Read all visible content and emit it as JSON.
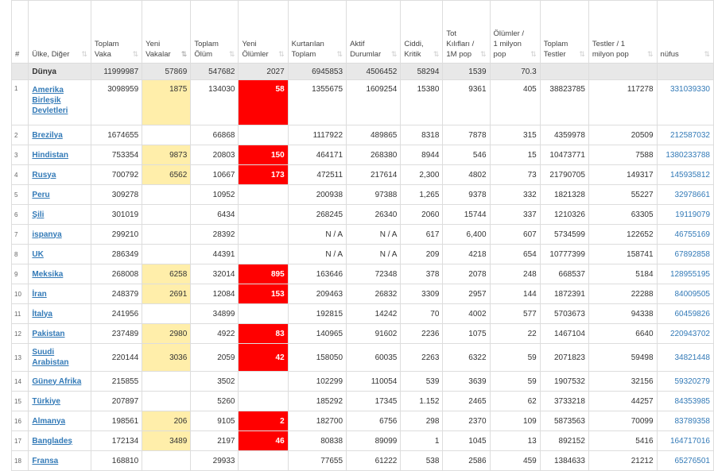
{
  "columns": [
    {
      "label": "#",
      "sort": false
    },
    {
      "label": "Ülke, Diğer",
      "sort": true
    },
    {
      "label": "Toplam Vaka",
      "sort": true
    },
    {
      "label": "Yeni Vakalar",
      "sort": true,
      "active": true
    },
    {
      "label": "Toplam Ölüm",
      "sort": true
    },
    {
      "label": "Yeni Ölümler",
      "sort": true
    },
    {
      "label": "Kurtarılan Toplam",
      "sort": true
    },
    {
      "label": "Aktif Durumlar",
      "sort": true
    },
    {
      "label": "Ciddi, Kritik",
      "sort": true
    },
    {
      "label": "Tot Kılıfları / 1M pop",
      "sort": true
    },
    {
      "label": "Ölümler / 1 milyon pop",
      "sort": true
    },
    {
      "label": "Toplam Testler",
      "sort": true
    },
    {
      "label": "Testler / 1 milyon pop",
      "sort": true
    },
    {
      "label": "nüfus",
      "sort": true
    }
  ],
  "sort_icon": "sort-arrows-icon",
  "world": {
    "idx": "",
    "country": "Dünya",
    "total": "11999987",
    "new_cases": "57869",
    "deaths": "547682",
    "new_deaths": "2027",
    "recovered": "6945853",
    "active": "4506452",
    "critical": "58294",
    "per_million": "1539",
    "deaths_per_million": "70.3",
    "tests": "",
    "tests_per_million": "",
    "population": ""
  },
  "rows": [
    {
      "idx": "1",
      "country": "Amerika Birleşik Devletleri",
      "total": "3098959",
      "new_cases": "1875",
      "deaths": "134030",
      "new_deaths": "58",
      "recovered": "1355675",
      "active": "1609254",
      "critical": "15380",
      "per_million": "9361",
      "deaths_per_million": "405",
      "tests": "38823785",
      "tests_per_million": "117278",
      "population": "331039330"
    },
    {
      "idx": "2",
      "country": "Brezilya",
      "total": "1674655",
      "new_cases": "",
      "deaths": "66868",
      "new_deaths": "",
      "recovered": "1117922",
      "active": "489865",
      "critical": "8318",
      "per_million": "7878",
      "deaths_per_million": "315",
      "tests": "4359978",
      "tests_per_million": "20509",
      "population": "212587032"
    },
    {
      "idx": "3",
      "country": "Hindistan",
      "total": "753354",
      "new_cases": "9873",
      "deaths": "20803",
      "new_deaths": "150",
      "recovered": "464171",
      "active": "268380",
      "critical": "8944",
      "per_million": "546",
      "deaths_per_million": "15",
      "tests": "10473771",
      "tests_per_million": "7588",
      "population": "1380233788"
    },
    {
      "idx": "4",
      "country": "Rusya",
      "total": "700792",
      "new_cases": "6562",
      "deaths": "10667",
      "new_deaths": "173",
      "recovered": "472511",
      "active": "217614",
      "critical": "2,300",
      "per_million": "4802",
      "deaths_per_million": "73",
      "tests": "21790705",
      "tests_per_million": "149317",
      "population": "145935812"
    },
    {
      "idx": "5",
      "country": "Peru",
      "total": "309278",
      "new_cases": "",
      "deaths": "10952",
      "new_deaths": "",
      "recovered": "200938",
      "active": "97388",
      "critical": "1,265",
      "per_million": "9378",
      "deaths_per_million": "332",
      "tests": "1821328",
      "tests_per_million": "55227",
      "population": "32978661"
    },
    {
      "idx": "6",
      "country": "Şili",
      "total": "301019",
      "new_cases": "",
      "deaths": "6434",
      "new_deaths": "",
      "recovered": "268245",
      "active": "26340",
      "critical": "2060",
      "per_million": "15744",
      "deaths_per_million": "337",
      "tests": "1210326",
      "tests_per_million": "63305",
      "population": "19119079"
    },
    {
      "idx": "7",
      "country": "ispanya",
      "total": "299210",
      "new_cases": "",
      "deaths": "28392",
      "new_deaths": "",
      "recovered": "N / A",
      "active": "N / A",
      "critical": "617",
      "per_million": "6,400",
      "deaths_per_million": "607",
      "tests": "5734599",
      "tests_per_million": "122652",
      "population": "46755169"
    },
    {
      "idx": "8",
      "country": "UK",
      "total": "286349",
      "new_cases": "",
      "deaths": "44391",
      "new_deaths": "",
      "recovered": "N / A",
      "active": "N / A",
      "critical": "209",
      "per_million": "4218",
      "deaths_per_million": "654",
      "tests": "10777399",
      "tests_per_million": "158741",
      "population": "67892858"
    },
    {
      "idx": "9",
      "country": "Meksika",
      "total": "268008",
      "new_cases": "6258",
      "deaths": "32014",
      "new_deaths": "895",
      "recovered": "163646",
      "active": "72348",
      "critical": "378",
      "per_million": "2078",
      "deaths_per_million": "248",
      "tests": "668537",
      "tests_per_million": "5184",
      "population": "128955195"
    },
    {
      "idx": "10",
      "country": "İran",
      "total": "248379",
      "new_cases": "2691",
      "deaths": "12084",
      "new_deaths": "153",
      "recovered": "209463",
      "active": "26832",
      "critical": "3309",
      "per_million": "2957",
      "deaths_per_million": "144",
      "tests": "1872391",
      "tests_per_million": "22288",
      "population": "84009505"
    },
    {
      "idx": "11",
      "country": "İtalya",
      "total": "241956",
      "new_cases": "",
      "deaths": "34899",
      "new_deaths": "",
      "recovered": "192815",
      "active": "14242",
      "critical": "70",
      "per_million": "4002",
      "deaths_per_million": "577",
      "tests": "5703673",
      "tests_per_million": "94338",
      "population": "60459826"
    },
    {
      "idx": "12",
      "country": "Pakistan",
      "total": "237489",
      "new_cases": "2980",
      "deaths": "4922",
      "new_deaths": "83",
      "recovered": "140965",
      "active": "91602",
      "critical": "2236",
      "per_million": "1075",
      "deaths_per_million": "22",
      "tests": "1467104",
      "tests_per_million": "6640",
      "population": "220943702"
    },
    {
      "idx": "13",
      "country": "Suudi Arabistan",
      "total": "220144",
      "new_cases": "3036",
      "deaths": "2059",
      "new_deaths": "42",
      "recovered": "158050",
      "active": "60035",
      "critical": "2263",
      "per_million": "6322",
      "deaths_per_million": "59",
      "tests": "2071823",
      "tests_per_million": "59498",
      "population": "34821448"
    },
    {
      "idx": "14",
      "country": "Güney Afrika",
      "total": "215855",
      "new_cases": "",
      "deaths": "3502",
      "new_deaths": "",
      "recovered": "102299",
      "active": "110054",
      "critical": "539",
      "per_million": "3639",
      "deaths_per_million": "59",
      "tests": "1907532",
      "tests_per_million": "32156",
      "population": "59320279"
    },
    {
      "idx": "15",
      "country": "Türkiye",
      "total": "207897",
      "new_cases": "",
      "deaths": "5260",
      "new_deaths": "",
      "recovered": "185292",
      "active": "17345",
      "critical": "1.152",
      "per_million": "2465",
      "deaths_per_million": "62",
      "tests": "3733218",
      "tests_per_million": "44257",
      "population": "84353985"
    },
    {
      "idx": "16",
      "country": "Almanya",
      "total": "198561",
      "new_cases": "206",
      "deaths": "9105",
      "new_deaths": "2",
      "recovered": "182700",
      "active": "6756",
      "critical": "298",
      "per_million": "2370",
      "deaths_per_million": "109",
      "tests": "5873563",
      "tests_per_million": "70099",
      "population": "83789358"
    },
    {
      "idx": "17",
      "country": "Bangladeş",
      "total": "172134",
      "new_cases": "3489",
      "deaths": "2197",
      "new_deaths": "46",
      "recovered": "80838",
      "active": "89099",
      "critical": "1",
      "per_million": "1045",
      "deaths_per_million": "13",
      "tests": "892152",
      "tests_per_million": "5416",
      "population": "164717016"
    },
    {
      "idx": "18",
      "country": "Fransa",
      "total": "168810",
      "new_cases": "",
      "deaths": "29933",
      "new_deaths": "",
      "recovered": "77655",
      "active": "61222",
      "critical": "538",
      "per_million": "2586",
      "deaths_per_million": "459",
      "tests": "1384633",
      "tests_per_million": "21212",
      "population": "65276501"
    }
  ],
  "highlight_colors": {
    "new_cases": "#ffeeaa",
    "new_deaths": "#ff0000"
  }
}
